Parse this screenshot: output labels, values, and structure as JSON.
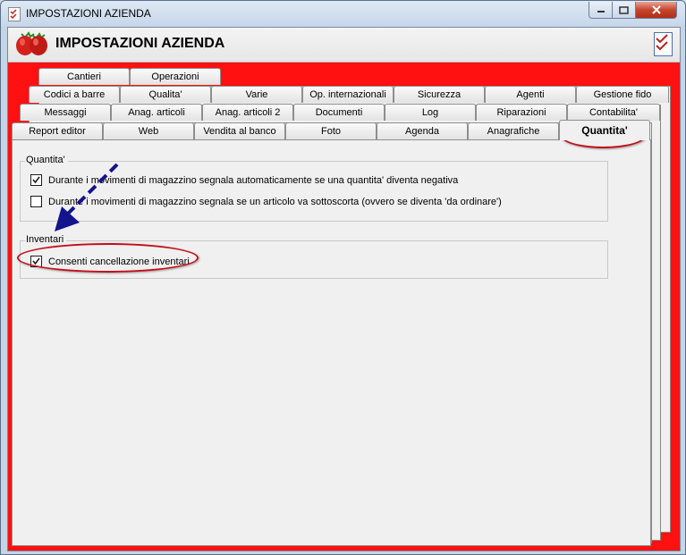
{
  "window": {
    "title": "IMPOSTAZIONI AZIENDA"
  },
  "header": {
    "title": "IMPOSTAZIONI AZIENDA"
  },
  "tabs": {
    "row1": [
      {
        "label": "Cantieri",
        "name": "tab-cantieri"
      },
      {
        "label": "Operazioni",
        "name": "tab-operazioni"
      }
    ],
    "row2": [
      {
        "label": "Codici a barre",
        "name": "tab-codici-a-barre"
      },
      {
        "label": "Qualita'",
        "name": "tab-qualita"
      },
      {
        "label": "Varie",
        "name": "tab-varie"
      },
      {
        "label": "Op. internazionali",
        "name": "tab-op-internazionali"
      },
      {
        "label": "Sicurezza",
        "name": "tab-sicurezza"
      },
      {
        "label": "Agenti",
        "name": "tab-agenti"
      },
      {
        "label": "Gestione fido",
        "name": "tab-gestione-fido"
      }
    ],
    "row3": [
      {
        "label": "Messaggi",
        "name": "tab-messaggi"
      },
      {
        "label": "Anag. articoli",
        "name": "tab-anag-articoli"
      },
      {
        "label": "Anag. articoli 2",
        "name": "tab-anag-articoli-2"
      },
      {
        "label": "Documenti",
        "name": "tab-documenti"
      },
      {
        "label": "Log",
        "name": "tab-log"
      },
      {
        "label": "Riparazioni",
        "name": "tab-riparazioni"
      },
      {
        "label": "Contabilita'",
        "name": "tab-contabilita"
      }
    ],
    "row4": [
      {
        "label": "Report editor",
        "name": "tab-report-editor"
      },
      {
        "label": "Web",
        "name": "tab-web"
      },
      {
        "label": "Vendita al banco",
        "name": "tab-vendita-al-banco"
      },
      {
        "label": "Foto",
        "name": "tab-foto"
      },
      {
        "label": "Agenda",
        "name": "tab-agenda"
      },
      {
        "label": "Anagrafiche",
        "name": "tab-anagrafiche"
      },
      {
        "label": "Quantita'",
        "name": "tab-quantita"
      }
    ],
    "active": "Quantita'"
  },
  "groups": {
    "quantita": {
      "label": "Quantita'",
      "options": [
        {
          "label": "Durante i movimenti di magazzino segnala automaticamente se una quantita' diventa negativa",
          "checked": true
        },
        {
          "label": "Durante i movimenti di magazzino segnala se un articolo va sottoscorta (ovvero se diventa 'da ordinare')",
          "checked": false
        }
      ]
    },
    "inventari": {
      "label": "Inventari",
      "options": [
        {
          "label": "Consenti cancellazione inventari",
          "checked": true
        }
      ]
    }
  },
  "colors": {
    "accent_red": "#ff1111",
    "highlight_ring": "#c2101a",
    "annotation_arrow": "#14148c"
  },
  "icons": {
    "app": "checklist-icon",
    "logo": "strawberries-logo",
    "header_action": "checklist-icon"
  }
}
